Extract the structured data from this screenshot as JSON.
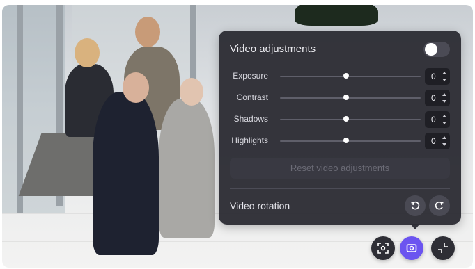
{
  "panel": {
    "title": "Video adjustments",
    "toggle_on": false,
    "sliders": [
      {
        "label": "Exposure",
        "value": "0"
      },
      {
        "label": "Contrast",
        "value": "0"
      },
      {
        "label": "Shadows",
        "value": "0"
      },
      {
        "label": "Highlights",
        "value": "0"
      }
    ],
    "reset_label": "Reset video adjustments",
    "rotation_label": "Video rotation"
  },
  "icons": {
    "rotate_left": "rotate-left-icon",
    "rotate_right": "rotate-right-icon",
    "focus": "focus-frame-icon",
    "camera": "camera-icon",
    "minimize": "minimize-icon"
  },
  "colors": {
    "panel_bg": "#2d2d34",
    "accent": "#6b54f0"
  }
}
